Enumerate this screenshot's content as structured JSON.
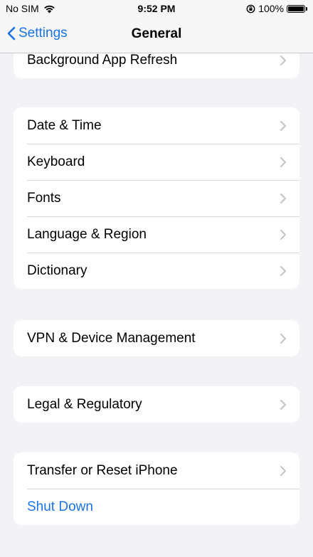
{
  "status_bar": {
    "carrier": "No SIM",
    "time": "9:52 PM",
    "battery": "100%",
    "battery_level": 1.0
  },
  "nav": {
    "back_label": "Settings",
    "title": "General"
  },
  "groups": [
    {
      "items": [
        {
          "label": "Background App Refresh"
        }
      ]
    },
    {
      "items": [
        {
          "label": "Date & Time"
        },
        {
          "label": "Keyboard"
        },
        {
          "label": "Fonts"
        },
        {
          "label": "Language & Region"
        },
        {
          "label": "Dictionary"
        }
      ]
    },
    {
      "items": [
        {
          "label": "VPN & Device Management"
        }
      ]
    },
    {
      "items": [
        {
          "label": "Legal & Regulatory"
        }
      ]
    },
    {
      "items": [
        {
          "label": "Transfer or Reset iPhone"
        },
        {
          "label": "Shut Down"
        }
      ]
    }
  ],
  "colors": {
    "accent": "#1a73e8",
    "background": "#f2f2f7"
  }
}
